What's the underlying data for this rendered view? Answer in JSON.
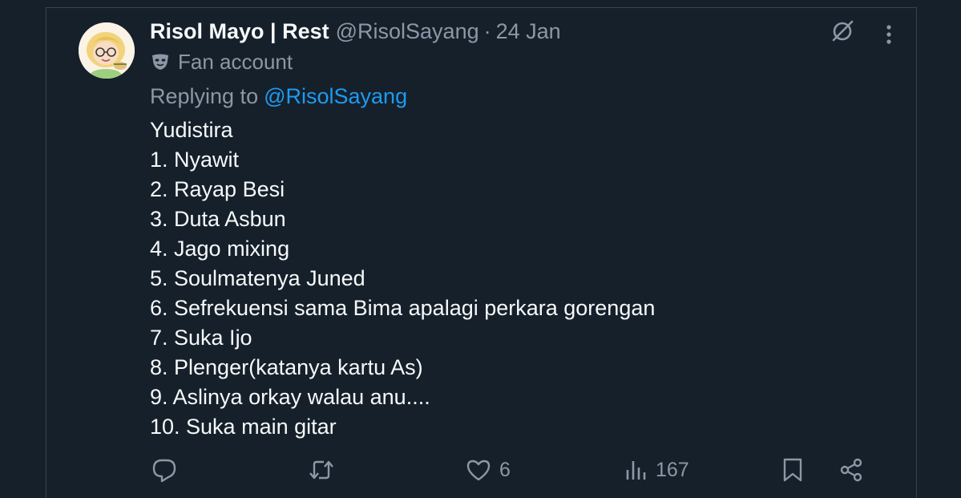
{
  "tweet": {
    "display_name": "Risol Mayo | Rest",
    "handle": "@RisolSayang",
    "separator": "·",
    "date": "24 Jan",
    "account_label": "Fan account",
    "replying_prefix": "Replying to",
    "replying_to": "@RisolSayang",
    "lines": [
      "Yudistira",
      "1. Nyawit",
      "2. Rayap Besi",
      "3. Duta Asbun",
      "4. Jago mixing",
      "5. Soulmatenya Juned",
      "6. Sefrekuensi sama Bima apalagi perkara gorengan",
      "7. Suka Ijo",
      "8. Plenger(katanya kartu As)",
      "9. Aslinya orkay walau anu....",
      "10. Suka main gitar"
    ]
  },
  "actions": {
    "reply_icon": "reply-icon",
    "retweet_icon": "retweet-icon",
    "like_icon": "heart-icon",
    "like_count": "6",
    "views_icon": "views-icon",
    "views_count": "167",
    "bookmark_icon": "bookmark-icon",
    "share_icon": "share-icon"
  },
  "colors": {
    "background": "#15202b",
    "text": "#f7f9f9",
    "muted": "#8b98a5",
    "link": "#1d9bf0",
    "border": "#38444d"
  }
}
